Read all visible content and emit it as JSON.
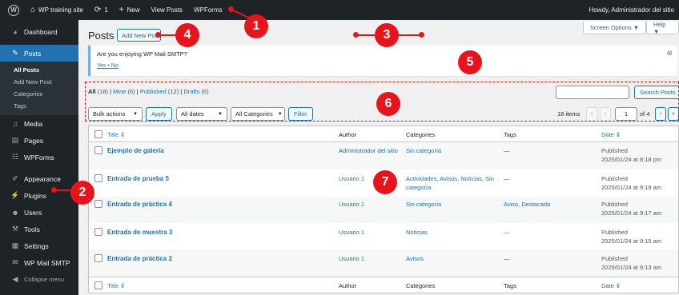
{
  "adminbar": {
    "site_name": "WP training site",
    "updates_count": "1",
    "new_label": "New",
    "view_posts": "View Posts",
    "wpforms": "WPForms",
    "howdy": "Howdy, Administrador del sitio"
  },
  "sidebar": {
    "dashboard": "Dashboard",
    "posts": "Posts",
    "submenu": [
      "All Posts",
      "Add New Post",
      "Categories",
      "Tags"
    ],
    "media": "Media",
    "pages": "Pages",
    "wpforms": "WPForms",
    "appearance": "Appearance",
    "plugins": "Plugins",
    "users": "Users",
    "tools": "Tools",
    "settings": "Settings",
    "wp_mail_smtp": "WP Mail SMTP",
    "collapse": "Collapse menu"
  },
  "header": {
    "screen_options": "Screen Options ▼",
    "help": "Help ▼",
    "title": "Posts",
    "add_new": "Add New Post"
  },
  "notice": {
    "text": "Are you enjoying WP Mail SMTP?",
    "yes": "Yes",
    "sep": "•",
    "no": "No"
  },
  "views": {
    "all": "All",
    "all_count": "(18)",
    "mine": "Mine",
    "mine_count": "(6)",
    "published": "Published",
    "published_count": "(12)",
    "drafts": "Drafts",
    "drafts_count": "(6)"
  },
  "search": {
    "button": "Search Posts"
  },
  "filters": {
    "bulk_actions": "Bulk actions",
    "apply": "Apply",
    "all_dates": "All dates",
    "all_categories": "All Categories",
    "filter": "Filter"
  },
  "pagination": {
    "items": "18 items",
    "first": "«",
    "prev": "‹",
    "current": "1",
    "of": "of 4",
    "next": "›",
    "last": "»"
  },
  "table": {
    "columns": {
      "title": "Title ⇕",
      "author": "Author",
      "categories": "Categories",
      "tags": "Tags",
      "date": "Date ⇕"
    },
    "rows": [
      {
        "title": "Ejemplo de galería",
        "author": "Administrador del sitio",
        "categories": "Sin categoría",
        "categories2": "",
        "tags": "—",
        "status": "Published",
        "date": "2025/01/24 at 8:18 pm"
      },
      {
        "title": "Entrada de prueba 5",
        "author": "Usuario 1",
        "categories": "Actividades, Avisos, Noticias, Sin",
        "categories2": "categoría",
        "tags": "—",
        "status": "Published",
        "date": "2025/01/24 at 9:19 am"
      },
      {
        "title": "Entrada de práctica 4",
        "author": "Usuario 1",
        "categories": "Sin categoría",
        "categories2": "",
        "tags": "Aviso, Destacada",
        "status": "Published",
        "date": "2025/01/24 at 9:17 am"
      },
      {
        "title": "Entrada de muestra 3",
        "author": "Usuario 1",
        "categories": "Noticias",
        "categories2": "",
        "tags": "—",
        "status": "Published",
        "date": "2025/01/24 at 9:15 am"
      },
      {
        "title": "Entrada de práctica 2",
        "author": "Usuario 1",
        "categories": "Avisos",
        "categories2": "",
        "tags": "—",
        "status": "Published",
        "date": "2025/01/24 at 9:13 am"
      }
    ]
  },
  "annotations": [
    "1",
    "2",
    "3",
    "4",
    "5",
    "6",
    "7"
  ],
  "colors": {
    "annotation": "#e8141c",
    "link": "#2271b1",
    "sidebar": "#1d2327",
    "active": "#2271b1"
  }
}
